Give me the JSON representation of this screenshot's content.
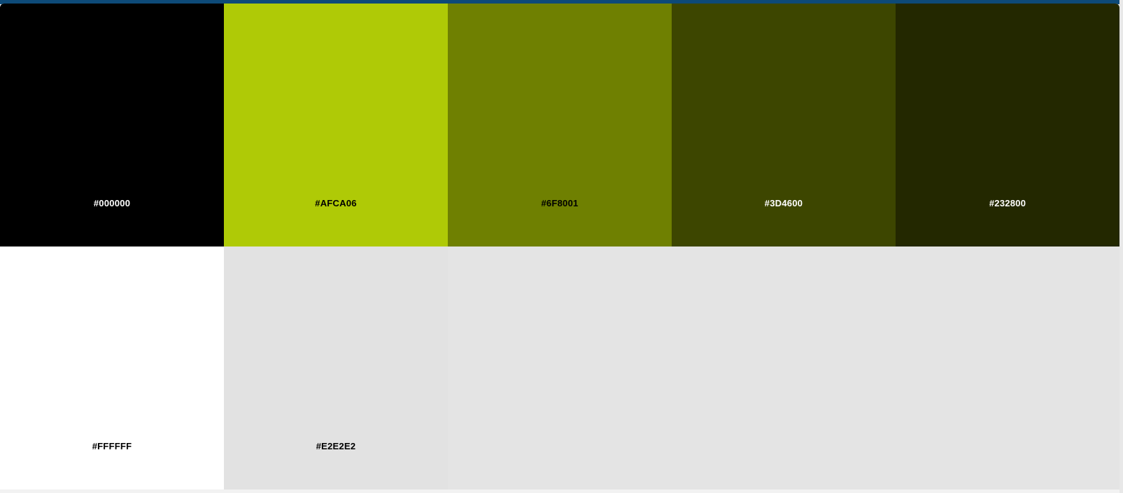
{
  "colors": {
    "top_strip": "#0d4a78",
    "page_background": "#f2f2f2",
    "empty_cell": "#e4e4e4"
  },
  "swatches": [
    {
      "hex": "#000000",
      "label": "#000000",
      "text_color": "#ffffff"
    },
    {
      "hex": "#AFCA06",
      "label": "#AFCA06",
      "text_color": "#000000"
    },
    {
      "hex": "#6F8001",
      "label": "#6F8001",
      "text_color": "#000000"
    },
    {
      "hex": "#3D4600",
      "label": "#3D4600",
      "text_color": "#ffffff"
    },
    {
      "hex": "#232800",
      "label": "#232800",
      "text_color": "#ffffff"
    },
    {
      "hex": "#FFFFFF",
      "label": "#FFFFFF",
      "text_color": "#000000"
    },
    {
      "hex": "#E2E2E2",
      "label": "#E2E2E2",
      "text_color": "#000000"
    }
  ]
}
